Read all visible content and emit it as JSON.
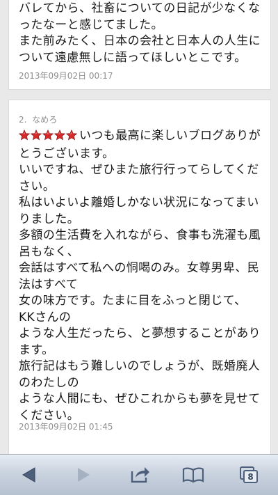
{
  "comment1": {
    "lines": [
      "バレてから、社畜についての日記が少なくな",
      "ったなーと感じてました。",
      "また前みたく、日本の会社と日本人の人生に",
      "ついて遠慮無しに語ってほしいとこです。"
    ],
    "date": "2013年09月02日 00:17"
  },
  "comment2": {
    "number": "2.",
    "author": "なめろ",
    "rating": 5,
    "star_color": "#d42a2a",
    "lines": [
      "いつも最高に楽しいブログありが",
      "とうございます。",
      "いいですね、ぜひまた旅行行ってらしてくだ",
      "さい。",
      "私はいよいよ離婚しかない状況になってまい",
      "りました。",
      "多額の生活費を入れながら、食事も洗濯も風",
      "呂もなく、",
      "会話はすべて私への恫喝のみ。女尊男卑、民",
      "法はすべて",
      "女の味方です。たまに目をふっと閉じて、",
      "KKさんの",
      "ような人生だったら、と夢想することがあり",
      "ます。",
      "旅行記はもう難しいのでしょうが、既婚廃人",
      "のわたしの",
      "ような人間にも、ぜひこれからも夢を見せて",
      "ください。"
    ],
    "date": "2013年09月02日 01:45"
  },
  "toolbar": {
    "tabs_count": "8",
    "icons": [
      "back-arrow-icon",
      "forward-arrow-icon",
      "share-icon",
      "bookmarks-icon",
      "tabs-icon"
    ]
  }
}
